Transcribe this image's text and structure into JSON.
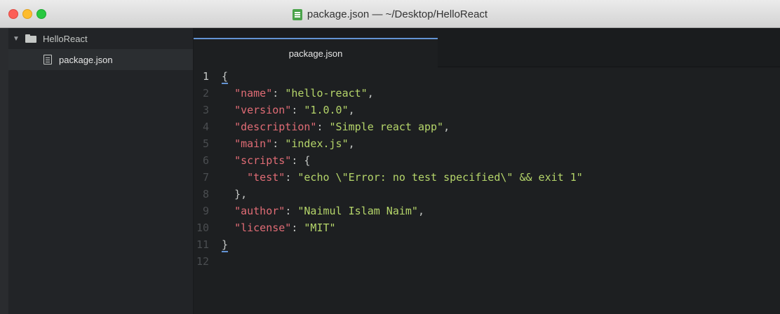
{
  "window": {
    "title": "package.json — ~/Desktop/HelloReact"
  },
  "sidebar": {
    "root_label": "HelloReact",
    "files": [
      {
        "label": "package.json"
      }
    ]
  },
  "tabs": [
    {
      "label": "package.json",
      "active": true
    }
  ],
  "editor": {
    "active_line": 1,
    "lines": [
      {
        "n": "1",
        "indent": "",
        "key": "",
        "sep": "",
        "val": "",
        "tail": "{"
      },
      {
        "n": "2",
        "indent": "  ",
        "key": "\"name\"",
        "sep": ": ",
        "val": "\"hello-react\"",
        "tail": ","
      },
      {
        "n": "3",
        "indent": "  ",
        "key": "\"version\"",
        "sep": ": ",
        "val": "\"1.0.0\"",
        "tail": ","
      },
      {
        "n": "4",
        "indent": "  ",
        "key": "\"description\"",
        "sep": ": ",
        "val": "\"Simple react app\"",
        "tail": ","
      },
      {
        "n": "5",
        "indent": "  ",
        "key": "\"main\"",
        "sep": ": ",
        "val": "\"index.js\"",
        "tail": ","
      },
      {
        "n": "6",
        "indent": "  ",
        "key": "\"scripts\"",
        "sep": ": ",
        "val": "",
        "tail": "{"
      },
      {
        "n": "7",
        "indent": "    ",
        "key": "\"test\"",
        "sep": ": ",
        "val": "\"echo \\\"Error: no test specified\\\" && exit 1\"",
        "tail": ""
      },
      {
        "n": "8",
        "indent": "  ",
        "key": "",
        "sep": "",
        "val": "",
        "tail": "},"
      },
      {
        "n": "9",
        "indent": "  ",
        "key": "\"author\"",
        "sep": ": ",
        "val": "\"Naimul Islam Naim\"",
        "tail": ","
      },
      {
        "n": "10",
        "indent": "  ",
        "key": "\"license\"",
        "sep": ": ",
        "val": "\"MIT\"",
        "tail": ""
      },
      {
        "n": "11",
        "indent": "",
        "key": "",
        "sep": "",
        "val": "",
        "tail": "}"
      },
      {
        "n": "12",
        "indent": "",
        "key": "",
        "sep": "",
        "val": "",
        "tail": ""
      }
    ]
  },
  "colors": {
    "json_key": "#e06c75",
    "json_string": "#b5d56a",
    "accent": "#6494d4"
  }
}
